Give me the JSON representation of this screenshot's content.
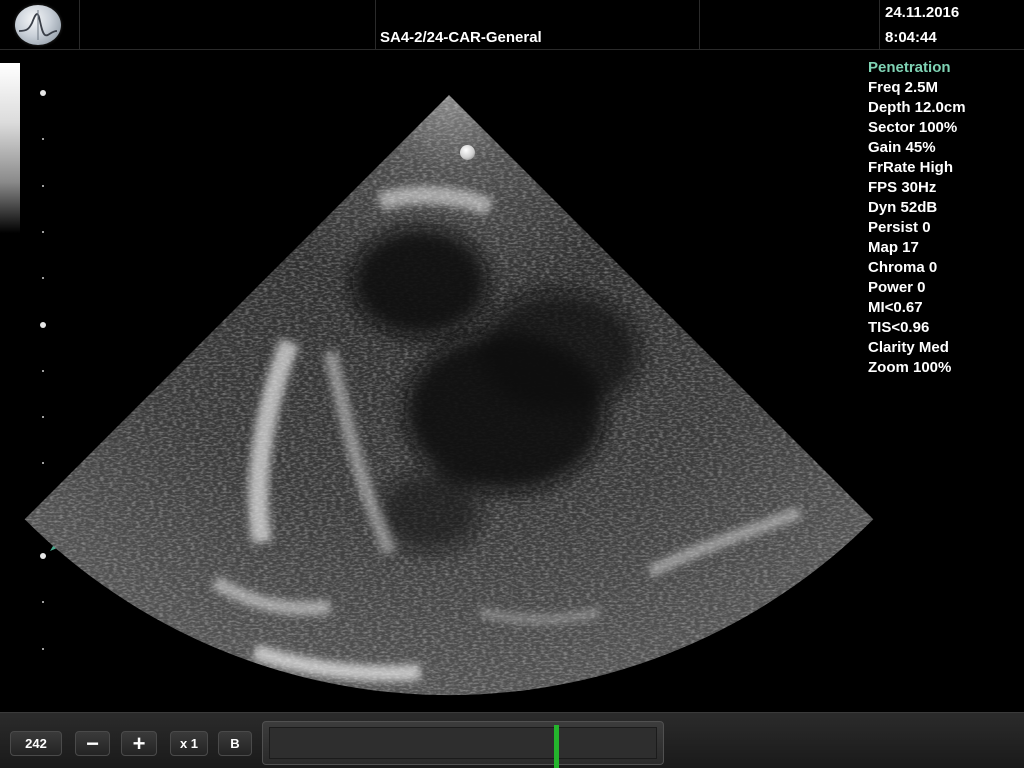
{
  "header": {
    "preset": "SA4-2/24-CAR-General",
    "date": "24.11.2016",
    "time": "8:04:44",
    "logo_icon": "waveform-logo-icon"
  },
  "params": {
    "mode": "Penetration",
    "lines": [
      "Freq 2.5M",
      "Depth 12.0cm",
      "Sector 100%",
      "Gain 45%",
      "FrRate High",
      "FPS 30Hz",
      "Dyn 52dB",
      "Persist 0",
      "Map 17",
      "Chroma 0",
      "Power 0",
      "MI<0.67",
      "TIS<0.96",
      "Clarity Med",
      "Zoom 100%"
    ]
  },
  "toolbar": {
    "frame_count": "242",
    "minus_label": "−",
    "plus_label": "+",
    "zoom_label": "x 1",
    "mode_label": "B",
    "cine_position": 0.74
  },
  "colors": {
    "mode_text": "#7fd3b4",
    "cine_cursor": "#24b52c",
    "background": "#000000"
  },
  "icons": {
    "focus_marker": "focus-arrow-icon",
    "probe_orientation": "probe-orientation-marker-icon"
  }
}
